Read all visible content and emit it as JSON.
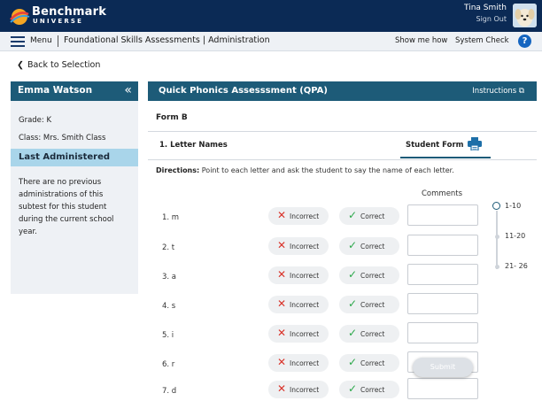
{
  "header": {
    "brand_name": "Benchmark",
    "brand_sub": "UNIVERSE",
    "user_name": "Tina Smith",
    "sign_out": "Sign Out"
  },
  "menubar": {
    "menu_label": "Menu",
    "breadcrumb": "Foundational Skills Assessments | Administration",
    "show_me_how": "Show me how",
    "system_check": "System Check",
    "help": "?"
  },
  "back_link": "Back to Selection",
  "student": {
    "name": "Emma Watson",
    "grade": "Grade: K",
    "class": "Class: Mrs. Smith Class",
    "last_administered_title": "Last Administered",
    "last_administered_msg": "There are no previous administrations of this subtest for this student during the current school year."
  },
  "assessment": {
    "title": "Quick Phonics Assesssment (QPA)",
    "instructions": "Instructions",
    "form": "Form B",
    "section": "1. Letter Names",
    "student_form": "Student Form",
    "directions_label": "Directions:",
    "directions_text": "Point to each letter and ask the student to say the name of each letter.",
    "comments_header": "Comments",
    "incorrect_label": "Incorrect",
    "correct_label": "Correct",
    "items": [
      {
        "label": "1. m"
      },
      {
        "label": "2. t"
      },
      {
        "label": "3. a"
      },
      {
        "label": "4. s"
      },
      {
        "label": "5. i"
      },
      {
        "label": "6. r"
      },
      {
        "label": "7. d"
      }
    ],
    "ranges": [
      "1-10",
      "11-20",
      "21- 26"
    ],
    "submit": "Submit"
  },
  "colors": {
    "topbar": "#0b2a55",
    "panel_header": "#1d5b78",
    "last_administered_bg": "#a9d5ea",
    "incorrect_icon": "#d9342b",
    "correct_icon": "#2ba84a"
  }
}
